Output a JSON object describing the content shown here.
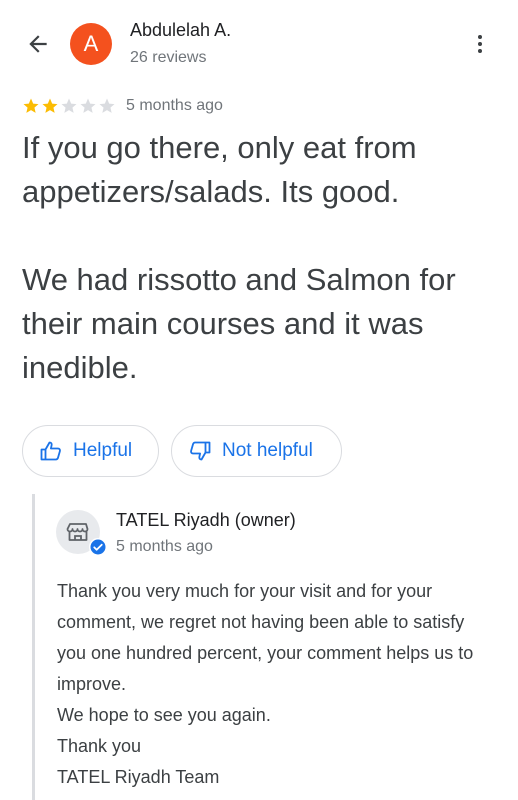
{
  "header": {
    "avatar_letter": "A",
    "avatar_color": "#f4511e",
    "author_name": "Abdulelah A.",
    "author_reviews": "26 reviews",
    "back_icon": "arrow-left-icon",
    "more_icon": "more-vert-icon"
  },
  "review": {
    "rating": 2,
    "rating_max": 5,
    "date": "5 months ago",
    "text": "If you go there, only eat from appetizers/salads. Its good.\n\nWe had rissotto and Salmon for their main courses and it was inedible."
  },
  "actions": {
    "helpful_label": "Helpful",
    "not_helpful_label": "Not helpful",
    "helpful_icon": "thumb-up-icon",
    "not_helpful_icon": "thumb-down-icon"
  },
  "owner_reply": {
    "owner_name": "TATEL Riyadh (owner)",
    "date": "5 months ago",
    "text": "Thank you very much for your visit and for your comment, we regret not having been able to satisfy you one hundred percent, your comment helps us to improve.\nWe hope to see you again.\nThank you\nTATEL Riyadh Team",
    "avatar_icon": "storefront-icon",
    "verified_icon": "verified-badge-icon"
  },
  "colors": {
    "accent": "#1a73e8",
    "star_filled": "#fbbc04",
    "star_empty": "#dadce0"
  }
}
